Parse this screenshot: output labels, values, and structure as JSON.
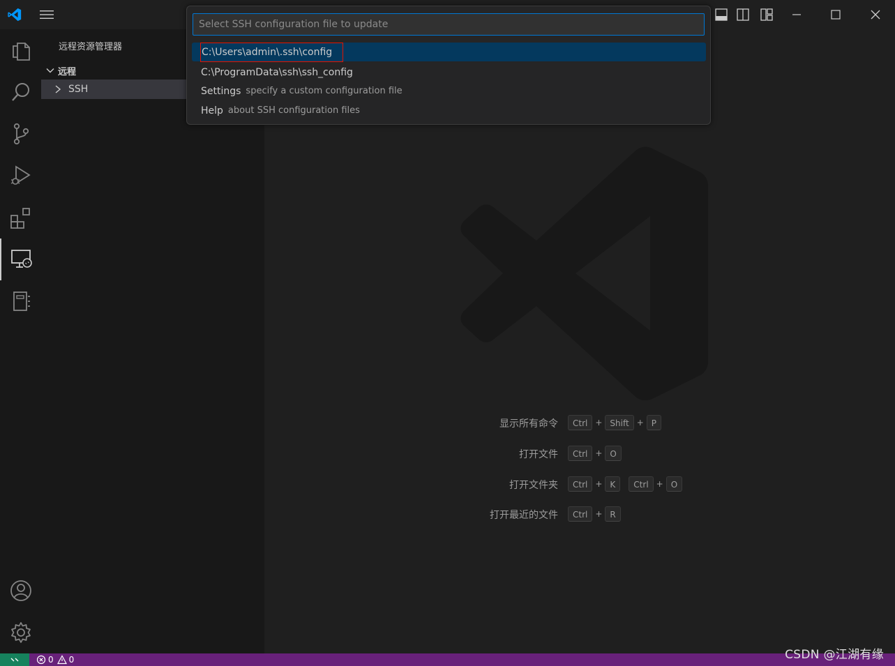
{
  "titlebar": {
    "logo_icon": "vscode-logo-icon",
    "menu_icon": "hamburger-menu-icon",
    "layout_icons": [
      "toggle-panel-icon",
      "toggle-secondary-sidebar-icon",
      "customize-layout-icon"
    ],
    "window_controls": [
      "minimize-icon",
      "maximize-icon",
      "close-icon"
    ]
  },
  "activitybar": {
    "top_items": [
      "explorer-icon",
      "search-icon",
      "source-control-icon",
      "run-debug-icon",
      "extensions-icon",
      "remote-explorer-icon",
      "notebook-icon"
    ],
    "bottom_items": [
      "accounts-icon",
      "settings-gear-icon"
    ],
    "active_item": "remote-explorer-icon"
  },
  "sidebar": {
    "title": "远程资源管理器",
    "section_label": "远程",
    "tree_item_label": "SSH"
  },
  "quickpick": {
    "placeholder": "Select SSH configuration file to update",
    "items": [
      {
        "label": "C:\\Users\\admin\\.ssh\\config",
        "description": ""
      },
      {
        "label": "C:\\ProgramData\\ssh\\ssh_config",
        "description": ""
      },
      {
        "label": "Settings",
        "description": "specify a custom configuration file"
      },
      {
        "label": "Help",
        "description": "about SSH configuration files"
      }
    ]
  },
  "editor": {
    "watermark_icon": "vscode-watermark-icon",
    "shortcuts": [
      {
        "label": "显示所有命令",
        "keys": [
          "Ctrl",
          "Shift",
          "P"
        ]
      },
      {
        "label": "打开文件",
        "keys": [
          "Ctrl",
          "O"
        ]
      },
      {
        "label": "打开文件夹",
        "keys": [
          "Ctrl",
          "K"
        ],
        "keys2": [
          "Ctrl",
          "O"
        ]
      },
      {
        "label": "打开最近的文件",
        "keys": [
          "Ctrl",
          "R"
        ]
      }
    ],
    "plus": "+"
  },
  "statusbar": {
    "errors": "0",
    "warnings": "0"
  },
  "watermark_text": "CSDN @江湖有缘",
  "colors": {
    "accent": "#0078d4",
    "selection": "#04395e",
    "statusbar": "#68217a",
    "remote_indicator": "#16825d",
    "highlight_box": "#e51400"
  }
}
